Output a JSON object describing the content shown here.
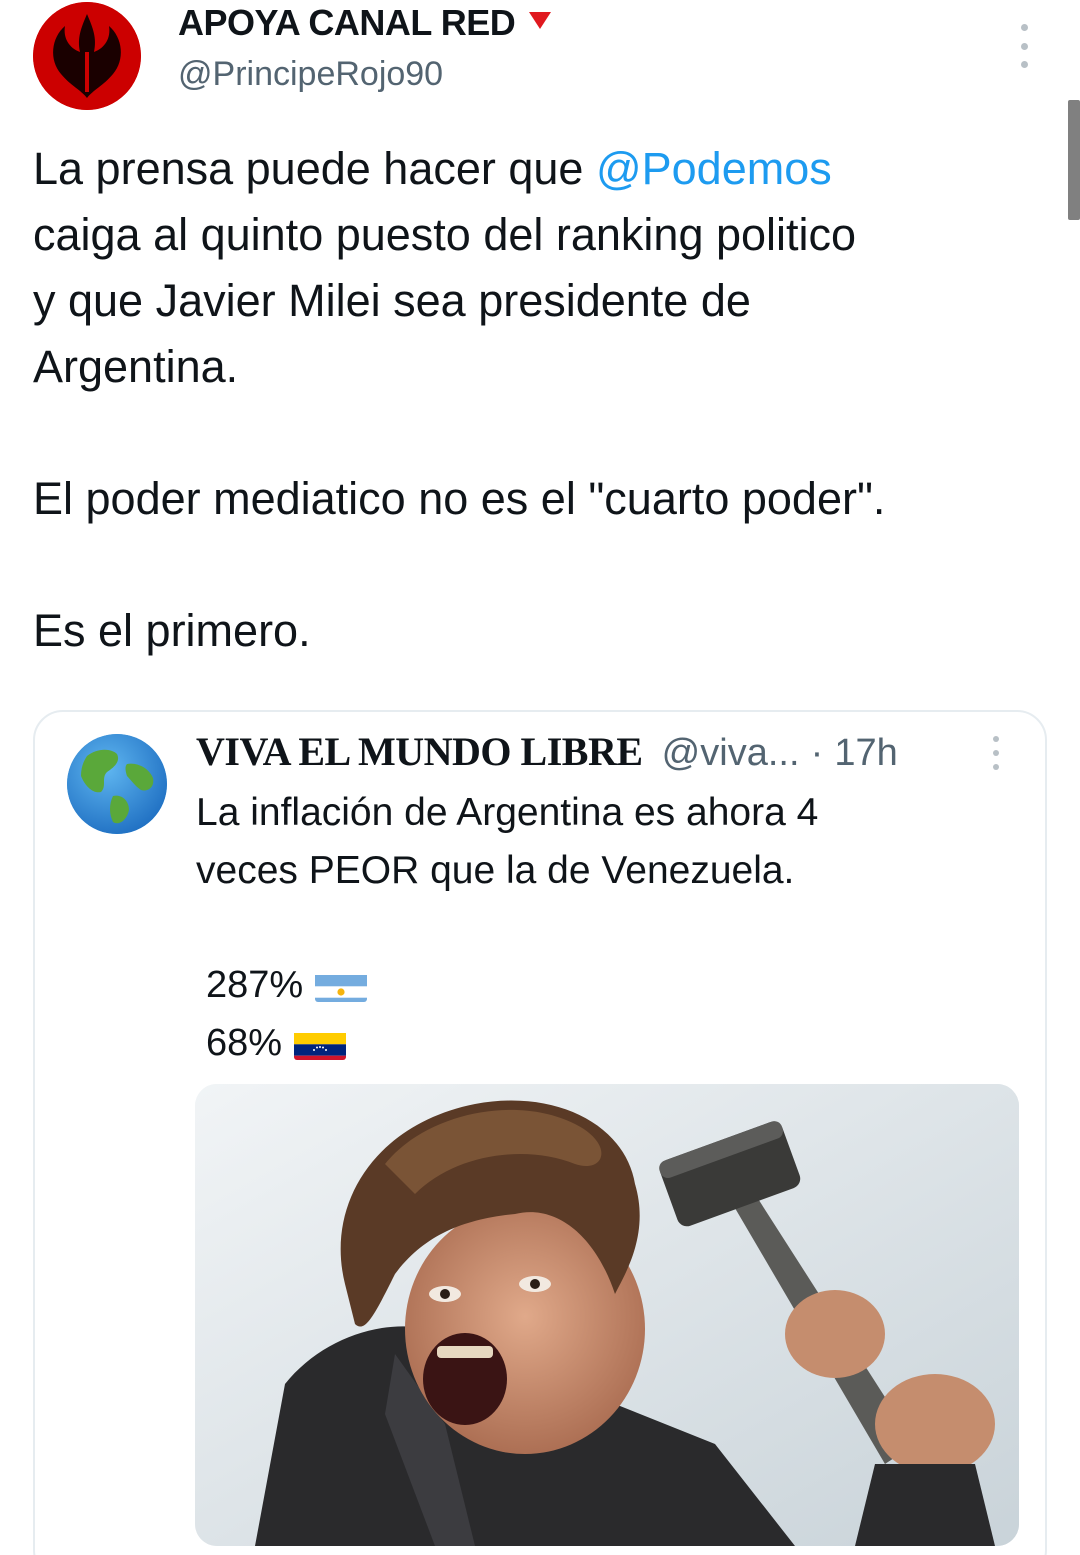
{
  "tweet": {
    "display_name": "APOYA CANAL RED",
    "handle": "@PrincipeRojo90",
    "lines": [
      {
        "before": "La prensa puede hacer que ",
        "mention": "@Podemos"
      },
      {
        "text": "caiga al quinto puesto del ranking politico"
      },
      {
        "text": "y que Javier Milei sea presidente de"
      },
      {
        "text": "Argentina."
      }
    ],
    "paragraph2": "El poder mediatico no es el \"cuarto poder\".",
    "paragraph3": "Es el primero."
  },
  "quote": {
    "display_name": "VIVA EL MUNDO LIBRE",
    "handle": "@viva...",
    "separator": "·",
    "time": "17h",
    "text_lines": [
      "La inflación de Argentina es ahora 4",
      "veces PEOR que la de Venezuela."
    ],
    "stats": [
      {
        "value": "287%",
        "flag": "argentina-flag-icon"
      },
      {
        "value": "68%",
        "flag": "venezuela-flag-icon"
      }
    ],
    "media_alt": "photo"
  },
  "icons": {
    "badge": "red-triangle-icon",
    "more": "more-options-icon",
    "avatar_main": "rebel-alliance-logo-icon",
    "avatar_quote": "earth-globe-icon"
  },
  "colors": {
    "text": "#0f1419",
    "secondary": "#536471",
    "link": "#1d9bf0",
    "badge": "#e0191f",
    "border": "#e6ecf0"
  }
}
